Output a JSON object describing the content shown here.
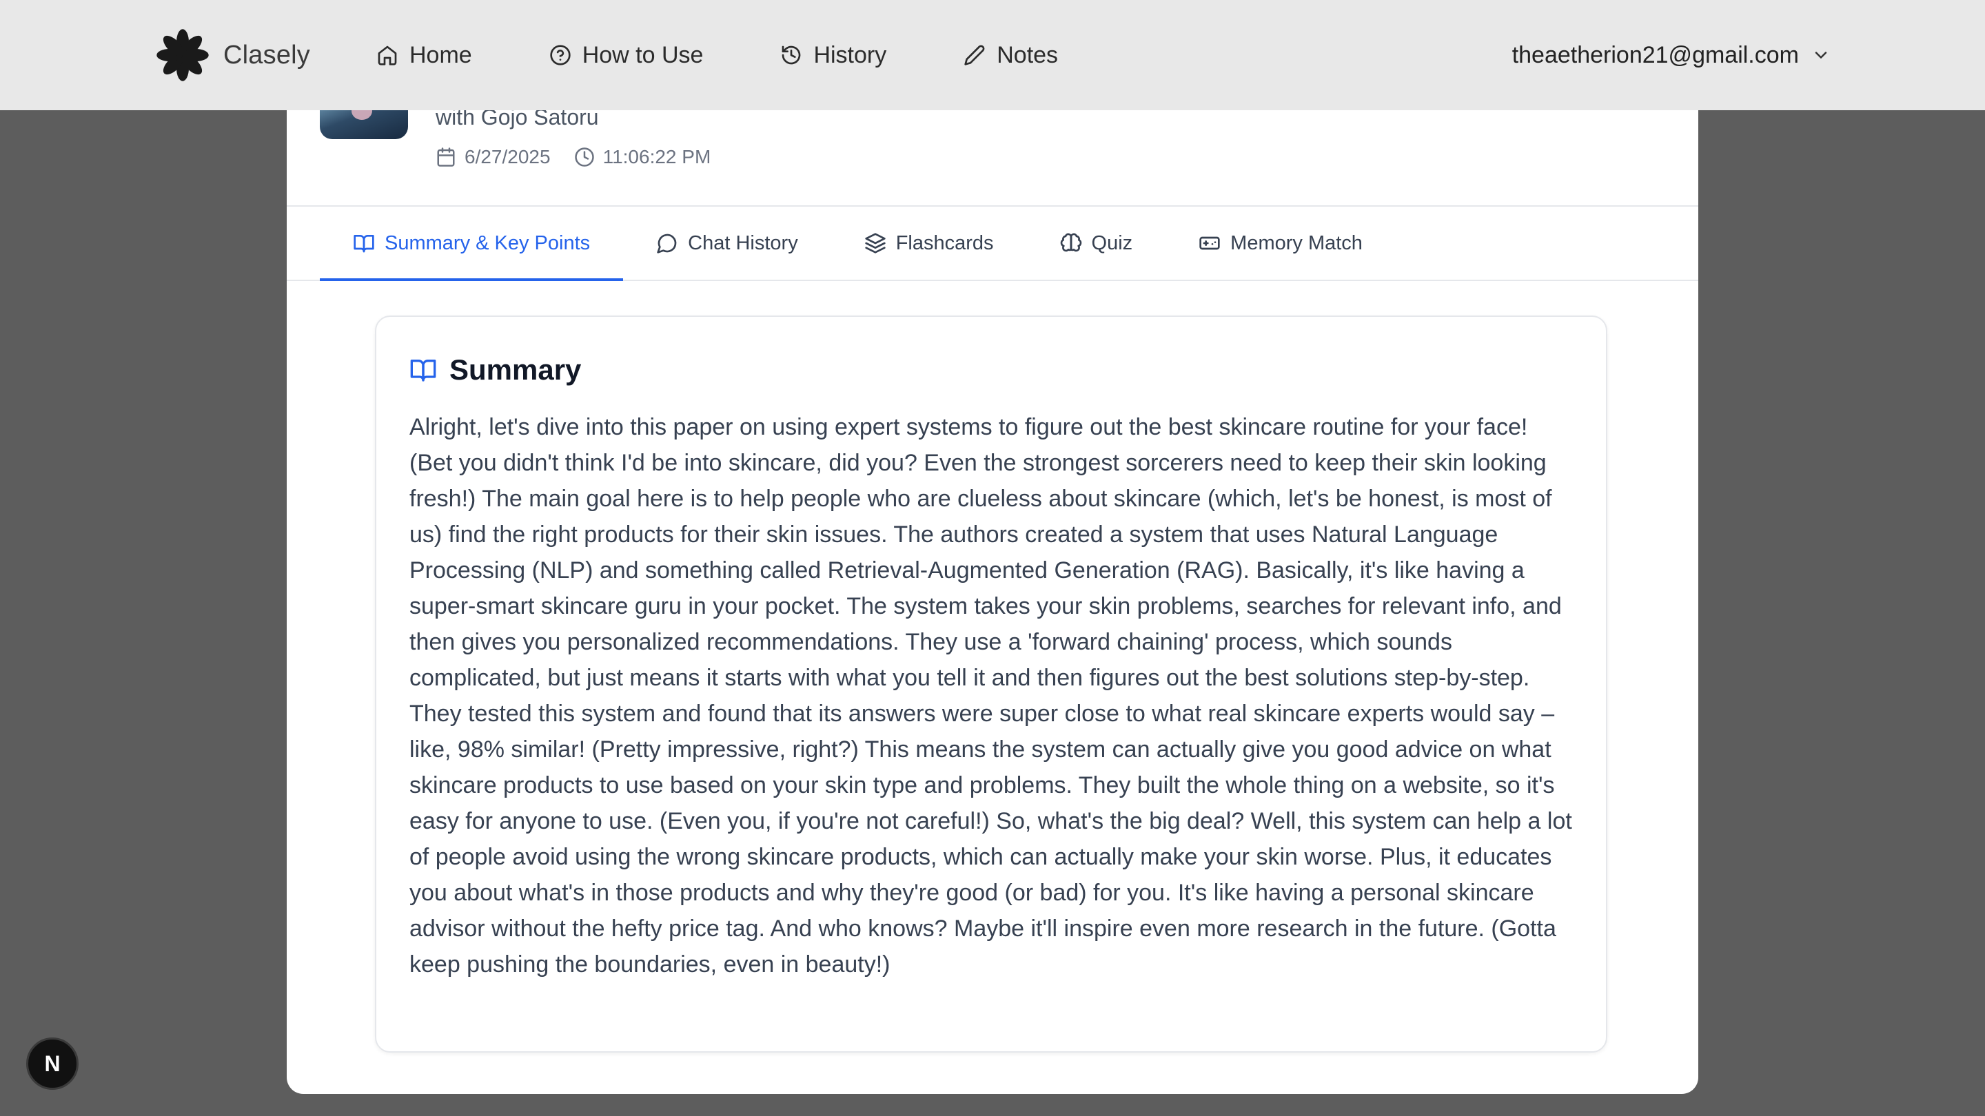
{
  "brand": {
    "name": "Clasely",
    "logo_icon": "asterisk-flower-logo",
    "color": "#1a1a1a"
  },
  "nav": {
    "items": [
      {
        "label": "Home",
        "icon": "home-icon"
      },
      {
        "label": "How to Use",
        "icon": "help-circle-icon"
      },
      {
        "label": "History",
        "icon": "history-icon"
      },
      {
        "label": "Notes",
        "icon": "pencil-icon"
      }
    ],
    "account": {
      "email": "theaetherion21@gmail.com",
      "icon": "chevron-down-icon"
    }
  },
  "session": {
    "subtitle": "with Gojo Satoru",
    "date": "6/27/2025",
    "time": "11:06:22 PM"
  },
  "tabs": [
    {
      "label": "Summary & Key Points",
      "icon": "book-open-icon",
      "active": true
    },
    {
      "label": "Chat History",
      "icon": "message-circle-icon",
      "active": false
    },
    {
      "label": "Flashcards",
      "icon": "layers-icon",
      "active": false
    },
    {
      "label": "Quiz",
      "icon": "brain-icon",
      "active": false
    },
    {
      "label": "Memory Match",
      "icon": "gamepad-icon",
      "active": false
    }
  ],
  "summary": {
    "title": "Summary",
    "text": "Alright, let's dive into this paper on using expert systems to figure out the best skincare routine for your face! (Bet you didn't think I'd be into skincare, did you? Even the strongest sorcerers need to keep their skin looking fresh!) The main goal here is to help people who are clueless about skincare (which, let's be honest, is most of us) find the right products for their skin issues.   The authors created a system that uses Natural Language Processing (NLP) and something called Retrieval-Augmented Generation (RAG). Basically, it's like having a super-smart skincare guru in your pocket. The system takes your skin problems, searches for relevant info, and then gives you personalized recommendations. They use a 'forward chaining' process, which sounds complicated, but just means it starts with what you tell it and then figures out the best solutions step-by-step.  They tested this system and found that its answers were super close to what real skincare experts would say – like, 98% similar! (Pretty impressive, right?) This means the system can actually give you good advice on what skincare products to use based on your skin type and problems. They built the whole thing on a website, so it's easy for anyone to use. (Even you, if you're not careful!)   So, what's the big deal? Well, this system can help a lot of people avoid using the wrong skincare products, which can actually make your skin worse. Plus, it educates you about what's in those products and why they're good (or bad) for you. It's like having a personal skincare advisor without the hefty price tag. And who knows? Maybe it'll inspire even more research in the future. (Gotta keep pushing the boundaries, even in beauty!)"
  },
  "dev_badge": {
    "label": "N"
  },
  "colors": {
    "accent": "#2563eb",
    "overlay": "#5d5d5d",
    "nav_bg": "#e8e8e8"
  }
}
